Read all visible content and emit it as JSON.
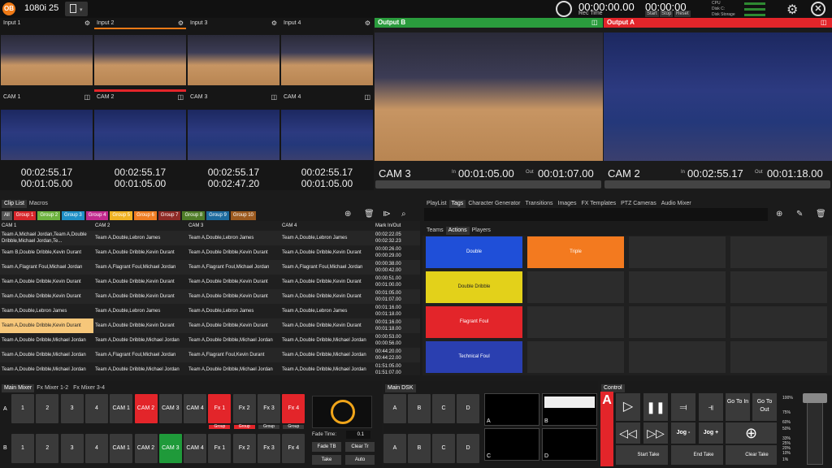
{
  "app": {
    "logo": "OB",
    "format": "1080i 25"
  },
  "recorder": {
    "rec_time": "00:00:00.00",
    "rec_label": "Rec Time",
    "sw_time": "00:00:00",
    "start": "Start",
    "stop": "Stop",
    "reset": "Reset"
  },
  "meters": {
    "cpu": "CPU",
    "disk_c": "Disk C:",
    "disk_storage": "Disk Storage"
  },
  "inputs": [
    {
      "label": "Input 1"
    },
    {
      "label": "Input 2"
    },
    {
      "label": "Input 3"
    },
    {
      "label": "Input 4"
    }
  ],
  "cams": [
    {
      "label": "CAM 1",
      "tc1": "00:02:55.17",
      "tc2": "00:01:05.00"
    },
    {
      "label": "CAM 2",
      "tc1": "00:02:55.17",
      "tc2": "00:01:05.00"
    },
    {
      "label": "CAM 3",
      "tc1": "00:02:55.17",
      "tc2": "00:02:47.20"
    },
    {
      "label": "CAM 4",
      "tc1": "00:02:55.17",
      "tc2": "00:01:05.00"
    }
  ],
  "outputs": {
    "b": {
      "label": "Output B",
      "color": "#2a9c3d",
      "cam": "CAM 3",
      "in_label": "In",
      "in_tc": "00:01:05.00",
      "out_label": "Out",
      "out_tc": "00:01:07.00"
    },
    "a": {
      "label": "Output A",
      "color": "#e3252a",
      "cam": "CAM 2",
      "in_label": "In",
      "in_tc": "00:02:55.17",
      "out_label": "Out",
      "out_tc": "00:01:18.00"
    }
  },
  "clip_tabs": [
    "Clip List",
    "Macros"
  ],
  "groups": [
    {
      "label": "All",
      "color": "#555"
    },
    {
      "label": "Group 1",
      "color": "#d8262b"
    },
    {
      "label": "Group 2",
      "color": "#6db33f"
    },
    {
      "label": "Group 3",
      "color": "#1f8fc6"
    },
    {
      "label": "Group 4",
      "color": "#c22a8e"
    },
    {
      "label": "Group 5",
      "color": "#f0b323"
    },
    {
      "label": "Group 6",
      "color": "#ef7d22"
    },
    {
      "label": "Group 7",
      "color": "#8e2a26"
    },
    {
      "label": "Group 8",
      "color": "#4f7c28"
    },
    {
      "label": "Group 9",
      "color": "#1d6a9e"
    },
    {
      "label": "Group 10",
      "color": "#9c5a1f"
    }
  ],
  "clip_table": {
    "headers": [
      "CAM 1",
      "CAM 2",
      "CAM 3",
      "CAM 4",
      "Mark In/Out"
    ],
    "rows": [
      [
        "Team A,Michael Jordan,Team A,Double Dribble,Michael Jordan,Te...",
        "Team A,Double,Lebron James",
        "Team A,Double,Lebron James",
        "Team A,Double,Lebron James",
        "00:02:22.05\n00:02:32.23"
      ],
      [
        "Team B,Double Dribble,Kevin Durant",
        "Team A,Double Dribble,Kevin Durant",
        "Team A,Double Dribble,Kevin Durant",
        "Team A,Double Dribble,Kevin Durant",
        "00:00:26.00\n00:00:29.00"
      ],
      [
        "Team A,Flagrant Foul,Michael Jordan",
        "Team A,Flagrant Foul,Michael Jordan",
        "Team A,Flagrant Foul,Michael Jordan",
        "Team A,Flagrant Foul,Michael Jordan",
        "00:00:38.00\n00:00:42.00"
      ],
      [
        "Team A,Double Dribble,Kevin Durant",
        "Team A,Double Dribble,Kevin Durant",
        "Team A,Double Dribble,Kevin Durant",
        "Team A,Double Dribble,Kevin Durant",
        "00:00:51.00\n00:01:00.00"
      ],
      [
        "Team A,Double Dribble,Kevin Durant",
        "Team A,Double Dribble,Kevin Durant",
        "Team A,Double Dribble,Kevin Durant",
        "Team A,Double Dribble,Kevin Durant",
        "00:01:05.00\n00:01:07.00"
      ],
      [
        "Team A,Double,Lebron James",
        "Team A,Double,Lebron James",
        "Team A,Double,Lebron James",
        "Team A,Double,Lebron James",
        "00:01:16.00\n00:01:18.00"
      ],
      [
        "Team A,Double Dribble,Kevin Durant",
        "Team A,Double Dribble,Kevin Durant",
        "Team A,Double Dribble,Kevin Durant",
        "Team A,Double Dribble,Kevin Durant",
        "00:01:16.00\n00:01:18.00"
      ],
      [
        "Team A,Double Dribble,Michael Jordan",
        "Team A,Double Dribble,Michael Jordan",
        "Team A,Double Dribble,Michael Jordan",
        "Team A,Double Dribble,Michael Jordan",
        "00:00:53.00\n00:00:56.00"
      ],
      [
        "Team A,Double Dribble,Michael Jordan",
        "Team A,Flagrant Foul,Michael Jordan",
        "Team A,Flagrant Foul,Kevin Durant",
        "Team A,Double Dribble,Michael Jordan",
        "00:44:20.00\n00:44:22.00"
      ],
      [
        "Team A,Double Dribble,Michael Jordan",
        "Team A,Double Dribble,Michael Jordan",
        "Team A,Double Dribble,Michael Jordan",
        "Team A,Double Dribble,Michael Jordan",
        "01:51:05.00\n01:51:07.00"
      ]
    ]
  },
  "right_tabs": [
    "PlayList",
    "Tags",
    "Character Generator",
    "Transitions",
    "Images",
    "FX Templates",
    "PTZ Cameras",
    "Audio Mixer"
  ],
  "tag_subtabs": [
    "Teams",
    "Actions",
    "Players"
  ],
  "tags": [
    {
      "label": "Double",
      "color": "#1f4fd8"
    },
    {
      "label": "Triple",
      "color": "#f37a1f"
    },
    {
      "label": "Double Dribble",
      "color": "#e3d11a"
    },
    {
      "label": "Flagrant Foul",
      "color": "#e3252a"
    },
    {
      "label": "Technical Foul",
      "color": "#2a3fb0"
    }
  ],
  "mixer_tabs": [
    "Main Mixer",
    "Fx Mixer 1-2",
    "Fx Mixer 3-4"
  ],
  "mixer": {
    "rowA_label": "A",
    "rowB_label": "B",
    "rowA": [
      "1",
      "2",
      "3",
      "4",
      "CAM 1",
      "CAM 2",
      "CAM 3",
      "CAM 4",
      "Fx 1",
      "Fx 2",
      "Fx 3",
      "Fx 4"
    ],
    "rowB": [
      "1",
      "2",
      "3",
      "4",
      "CAM 1",
      "CAM 2",
      "CAM 3",
      "CAM 4",
      "Fx 1",
      "Fx 2",
      "Fx 3",
      "Fx 4"
    ],
    "group_label": "Group",
    "fade_time_label": "Fade Time:",
    "fade_time_value": "0.1",
    "fade_tb": "Fade TB",
    "clear_tr": "Clear Tr",
    "take": "Take",
    "auto": "Auto"
  },
  "dsk": {
    "tab": "Main DSK",
    "row1": [
      "A",
      "B",
      "C",
      "D"
    ],
    "row2": [
      "A",
      "B",
      "C",
      "D"
    ],
    "thumbs": [
      "A",
      "B",
      "C",
      "D"
    ]
  },
  "control": {
    "tab": "Control",
    "label": "A",
    "go_to_in": "Go To In",
    "go_to_out": "Go To Out",
    "jog_minus": "Jog -",
    "jog_plus": "Jog +",
    "start_take": "Start Take",
    "end_take": "End Take",
    "clear_take": "Clear Take",
    "speeds": [
      "100%",
      "75%",
      "60%",
      "50%",
      "33%",
      "25%",
      "20%",
      "10%",
      "1%"
    ]
  }
}
